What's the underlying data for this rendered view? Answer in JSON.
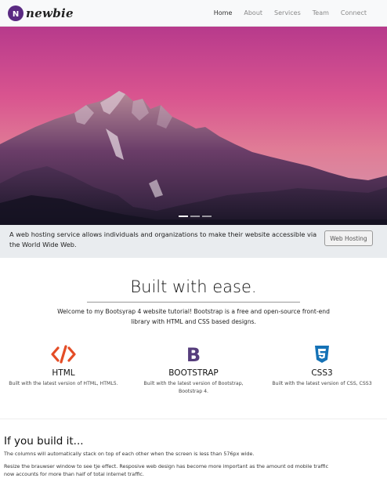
{
  "navbar": {
    "brand": "newbie",
    "links": [
      "Home",
      "About",
      "Services",
      "Team",
      "Connect"
    ],
    "active": "Home"
  },
  "carousel": {
    "indicator_count": 3,
    "active_index": 0
  },
  "jumbotron": {
    "text": "A web hosting service allows individuals and organizations to make their website accessible via the World Wide Web.",
    "button": "Web Hosting"
  },
  "welcome": {
    "heading": "Built with ease.",
    "lead": "Welcome to my Bootsyrap 4 website tutorial! Bootstrap is a free and open-source front-end library with HTML and CSS based designs."
  },
  "features": [
    {
      "icon": "html5-icon",
      "title": "HTML",
      "desc": "Built with the latest version of HTML, HTML5.",
      "color": "#e44d26"
    },
    {
      "icon": "bootstrap-icon",
      "title": "BOOTSTRAP",
      "desc": "Built with the latest version of Bootstrap, Bootstrap 4.",
      "color": "#563d7c"
    },
    {
      "icon": "css3-icon",
      "title": "CSS3",
      "desc": "Built with the latest version of CSS, CSS3",
      "color": "#1572b6"
    }
  ],
  "section": {
    "heading": "If you build it...",
    "para1": "The columns will automatically stack on top of each other when the screen is less than 576px wide.",
    "para2": "Resize the brauwser window to see tje effect. Resposive web design has become more important as the amount od mobile traffic now accounts for more than half of total internet traffic."
  }
}
